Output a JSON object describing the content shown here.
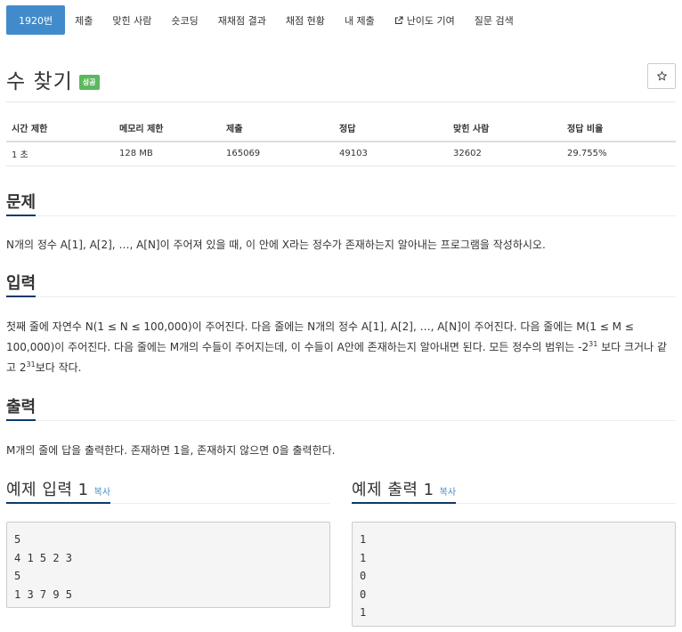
{
  "tabs": [
    {
      "label": "1920번",
      "active": true
    },
    {
      "label": "제출"
    },
    {
      "label": "맞힌 사람"
    },
    {
      "label": "숏코딩"
    },
    {
      "label": "재채점 결과"
    },
    {
      "label": "채점 현황"
    },
    {
      "label": "내 제출"
    },
    {
      "label": "난이도 기여",
      "icon": "external-link-icon"
    },
    {
      "label": "질문 검색"
    }
  ],
  "problem": {
    "title": "수 찾기",
    "status_badge": "성공",
    "star_icon": "star-outline-icon"
  },
  "info_table": {
    "headers": [
      "시간 제한",
      "메모리 제한",
      "제출",
      "정답",
      "맞힌 사람",
      "정답 비율"
    ],
    "values": [
      "1 초",
      "128 MB",
      "165069",
      "49103",
      "32602",
      "29.755%"
    ]
  },
  "sections": {
    "description_heading": "문제",
    "description_text": "N개의 정수 A[1], A[2], …, A[N]이 주어져 있을 때, 이 안에 X라는 정수가 존재하는지 알아내는 프로그램을 작성하시오.",
    "input_heading": "입력",
    "input_text_1": "첫째 줄에 자연수 N(1 ≤ N ≤ 100,000)이 주어진다. 다음 줄에는 N개의 정수 A[1], A[2], …, A[N]이 주어진다. 다음 줄에는 M(1 ≤ M ≤ 100,000)이 주어진다. 다음 줄에는 M개의 수들이 주어지는데, 이 수들이 A안에 존재하는지 알아내면 된다. 모든 정수의 범위는 -2",
    "input_exp_1": "31",
    "input_text_2": " 보다 크거나 같고 2",
    "input_exp_2": "31",
    "input_text_3": "보다 작다.",
    "output_heading": "출력",
    "output_text": "M개의 줄에 답을 출력한다. 존재하면 1을, 존재하지 않으면 0을 출력한다."
  },
  "samples": {
    "input_heading": "예제 입력 1",
    "output_heading": "예제 출력 1",
    "copy_label": "복사",
    "input_lines": [
      "5",
      "4 1 5 2 3",
      "5",
      "1 3 7 9 5"
    ],
    "output_lines": [
      "1",
      "1",
      "0",
      "0",
      "1"
    ]
  },
  "colors": {
    "accent": "#428bca",
    "success": "#5cb85c",
    "heading_underline": "#0d3a6b"
  }
}
